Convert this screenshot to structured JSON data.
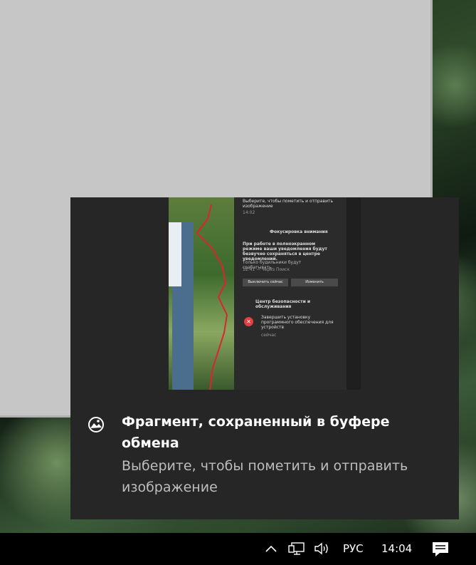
{
  "notification": {
    "title": "Фрагмент, сохраненный в буфере обмена",
    "body": "Выберите, чтобы пометить и отправить изображение",
    "icon": "snip-icon"
  },
  "preview": {
    "top_text": "Выберите, чтобы пометить и отправить изображение",
    "top_time": "14:02",
    "focus_header": "Фокусировка внимания",
    "focus_text": "При работе в полноэкранном режиме ваши уведомления будут безвучно сохраняться в центре уведомлений.",
    "focus_sub": "Только будильники будут срабатывать.",
    "focus_time": "12:41 — через Поиск",
    "btn_off": "Выключить сейчас",
    "btn_change": "Изменить",
    "security_header": "Центр безопасности и обслуживания",
    "security_text": "Завершить установку программного обеспечения для устройств",
    "security_time": "сейчас"
  },
  "taskbar": {
    "language": "РУС",
    "time": "14:04"
  }
}
